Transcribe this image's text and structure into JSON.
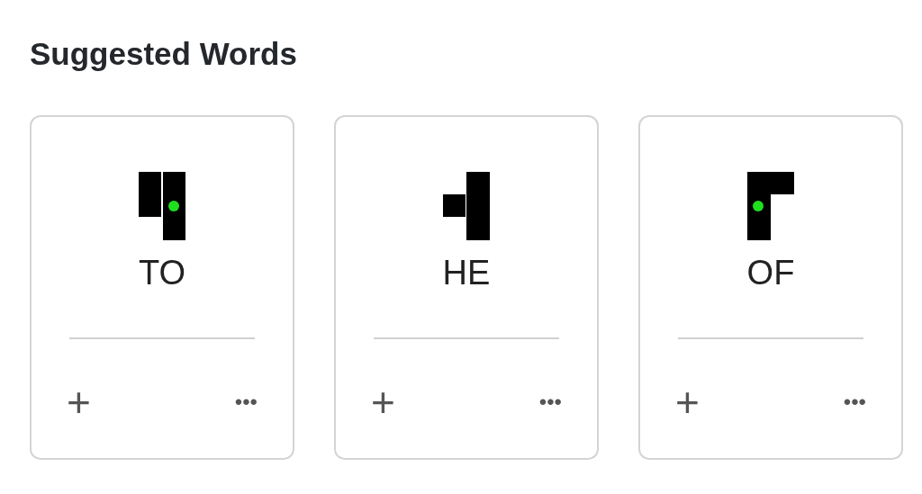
{
  "title": "Suggested Words",
  "cards": [
    {
      "word": "TO",
      "kind": "split",
      "add": "+",
      "more": "•••"
    },
    {
      "word": "HE",
      "kind": "tee",
      "add": "+",
      "more": "•••"
    },
    {
      "word": "OF",
      "kind": "corner",
      "add": "+",
      "more": "•••"
    }
  ]
}
